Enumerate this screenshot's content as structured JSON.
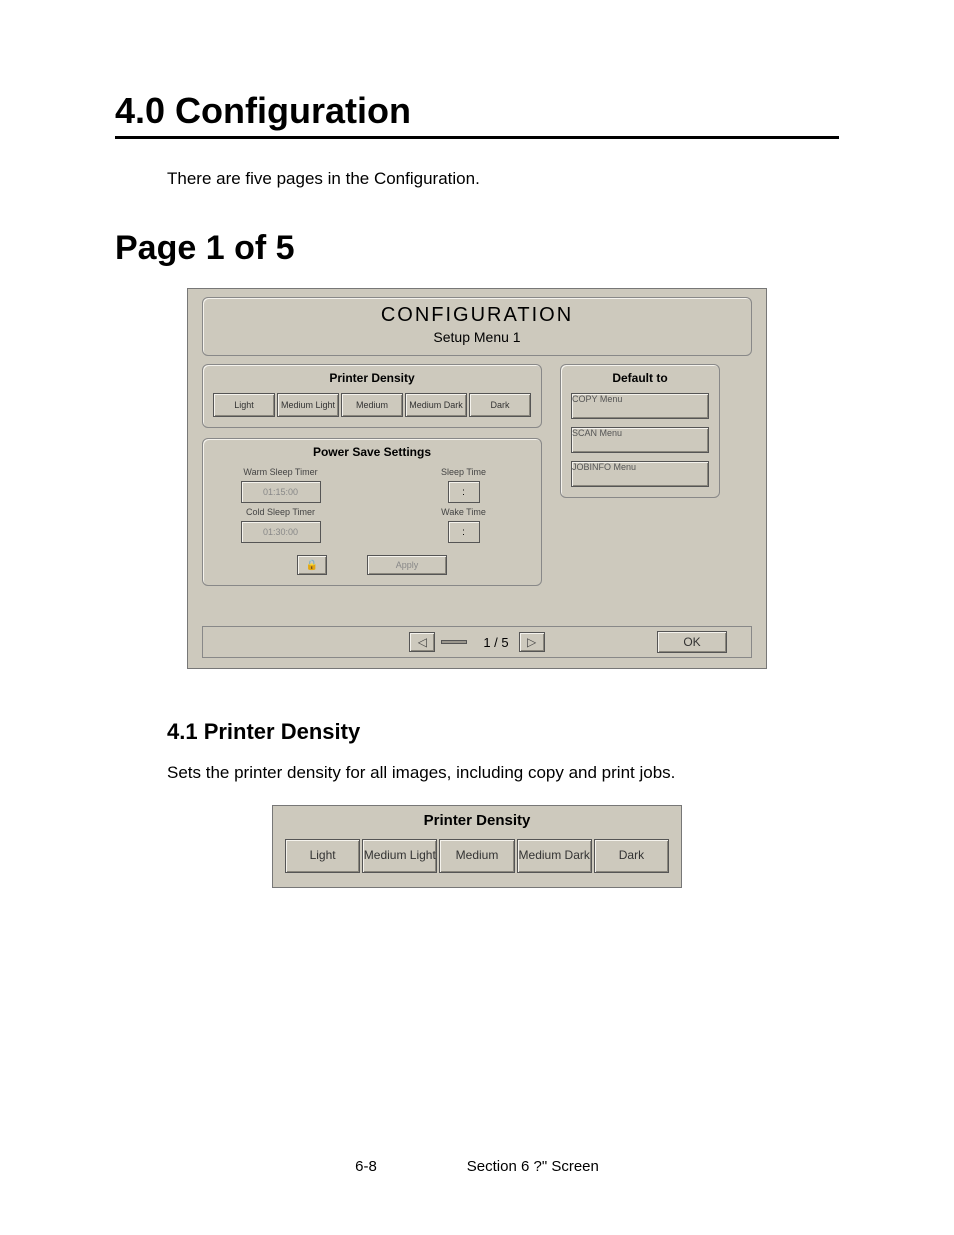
{
  "heading1": "4.0  Configuration",
  "intro": "There are five pages in the Configuration.",
  "heading2": "Page 1 of 5",
  "config_panel": {
    "title": "CONFIGURATION",
    "subtitle": "Setup Menu 1",
    "printer_density": {
      "title": "Printer Density",
      "options": [
        "Light",
        "Medium Light",
        "Medium",
        "Medium Dark",
        "Dark"
      ]
    },
    "power_save": {
      "title": "Power Save Settings",
      "warm_label": "Warm Sleep Timer",
      "warm_value": "01:15:00",
      "cold_label": "Cold Sleep Timer",
      "cold_value": "01:30:00",
      "sleep_label": "Sleep Time",
      "sleep_value": ":",
      "wake_label": "Wake Time",
      "wake_value": ":",
      "apply": "Apply"
    },
    "default_to": {
      "title": "Default to",
      "items": [
        "COPY Menu",
        "SCAN Menu",
        "JOBINFO Menu"
      ]
    },
    "footer": {
      "page": "1 / 5",
      "ok": "OK"
    }
  },
  "heading3": "4.1  Printer Density",
  "body41": "Sets the printer density for all images, including copy and print jobs.",
  "density_panel": {
    "title": "Printer Density",
    "options": [
      "Light",
      "Medium Light",
      "Medium",
      "Medium Dark",
      "Dark"
    ]
  },
  "page_footer": {
    "left": "6-8",
    "right": "Section 6    ?\" Screen"
  }
}
